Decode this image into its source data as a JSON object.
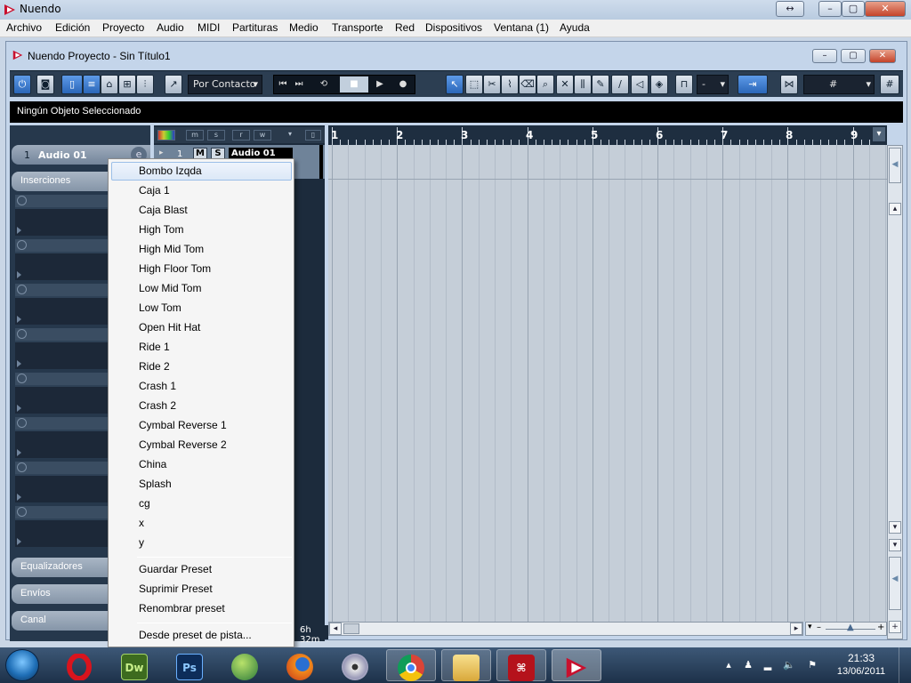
{
  "app": {
    "title": "Nuendo"
  },
  "menubar": {
    "items": [
      "Archivo",
      "Edición",
      "Proyecto",
      "Audio",
      "MIDI",
      "Partituras",
      "Medio",
      "Transporte",
      "Red",
      "Dispositivos",
      "Ventana (1)",
      "Ayuda"
    ]
  },
  "project": {
    "title": "Nuendo Proyecto - Sin Título1"
  },
  "toolbar": {
    "mode_select": "Por Contacto",
    "quantize_value": "-"
  },
  "infoline": {
    "text": "Ningún Objeto Seleccionado"
  },
  "inspector": {
    "track_number": "1",
    "track_name": "Audio 01",
    "sections": {
      "inserts": "Inserciones",
      "eq": "Equalizadores",
      "sends": "Envíos",
      "channel": "Canal"
    }
  },
  "tracklist": {
    "track_number": "1",
    "mute": "M",
    "solo": "S",
    "track_name": "Audio 01",
    "time_display": "6h 32m",
    "toolbar_labels": [
      "m",
      "s",
      "r",
      "w"
    ]
  },
  "ruler": {
    "bars": [
      "1",
      "2",
      "3",
      "4",
      "5",
      "6",
      "7",
      "8",
      "9"
    ]
  },
  "context_menu": {
    "presets": [
      "Bombo Izqda",
      "Caja 1",
      "Caja Blast",
      "High Tom",
      "High Mid Tom",
      "High Floor Tom",
      "Low Mid Tom",
      "Low Tom",
      "Open Hit Hat",
      "Ride 1",
      "Ride 2",
      "Crash 1",
      "Crash 2",
      "Cymbal Reverse 1",
      "Cymbal Reverse 2",
      "China",
      "Splash",
      "cg",
      "x",
      "y"
    ],
    "actions": [
      "Guardar Preset",
      "Suprimir Preset",
      "Renombrar preset"
    ],
    "footer": "Desde preset de pista..."
  },
  "taskbar": {
    "apps": [
      "start",
      "opera",
      "dreamweaver",
      "photoshop",
      "globe",
      "firefox",
      "dvd",
      "chrome",
      "explorer",
      "acrobat",
      "nuendo"
    ],
    "dreamweaver_label": "Dw",
    "photoshop_label": "Ps",
    "time": "21:33",
    "date": "13/06/2011"
  }
}
